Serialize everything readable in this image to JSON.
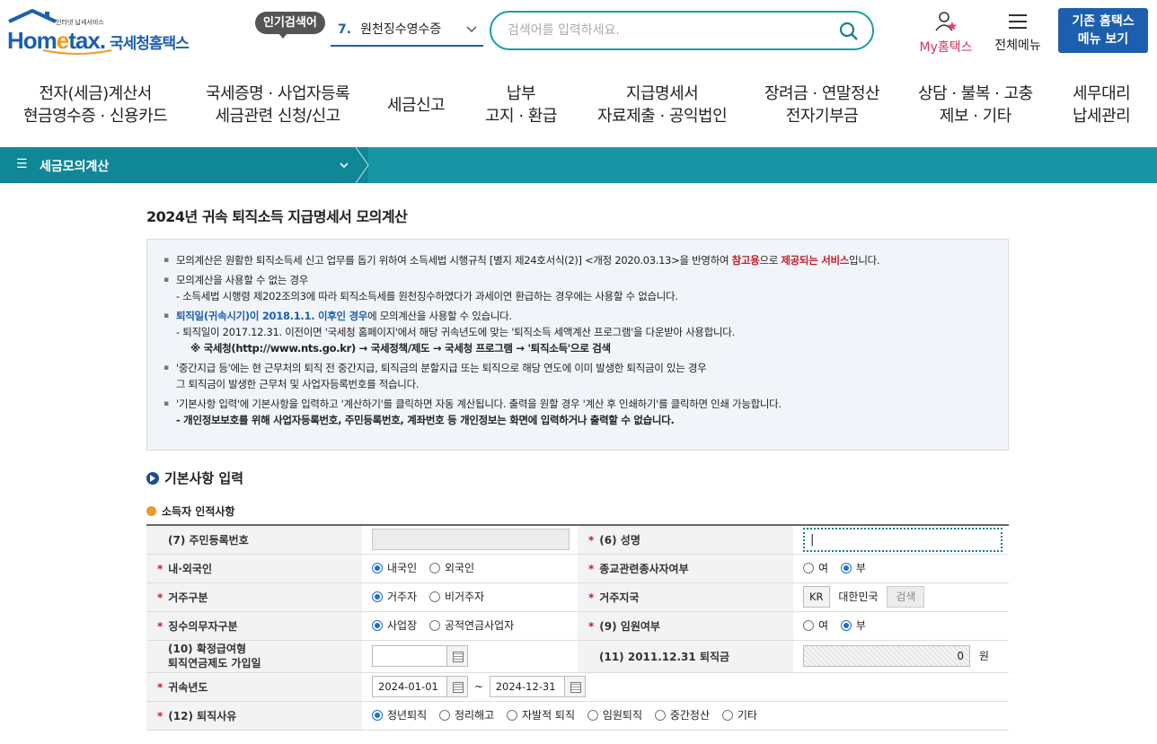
{
  "header": {
    "logo_small": "인터넷 납세서비스",
    "logo_brand_pre": "Hom",
    "logo_brand_e": "e",
    "logo_brand_post": "tax.",
    "logo_kr": "국세청홈택스",
    "popular_badge": "인기검색어",
    "popular_num": "7.",
    "popular_term": "원천징수영수증",
    "search_placeholder": "검색어를 입력하세요.",
    "my_hometax": "My홈택스",
    "all_menu": "전체메뉴",
    "old_hometax_line1": "기존 홈택스",
    "old_hometax_line2": "메뉴 보기"
  },
  "gnb": [
    {
      "l1": "전자(세금)계산서",
      "l2": "현금영수증 · 신용카드"
    },
    {
      "l1": "국세증명 · 사업자등록",
      "l2": "세금관련 신청/신고"
    },
    {
      "l1": "세금신고",
      "l2": ""
    },
    {
      "l1": "납부",
      "l2": "고지 · 환급"
    },
    {
      "l1": "지급명세서",
      "l2": "자료제출 · 공익법인"
    },
    {
      "l1": "장려금 · 연말정산",
      "l2": "전자기부금"
    },
    {
      "l1": "상담 · 불복 · 고충",
      "l2": "제보 · 기타"
    },
    {
      "l1": "세무대리",
      "l2": "납세관리"
    }
  ],
  "subbar": {
    "title": "세금모의계산"
  },
  "page_title": "2024년 귀속 퇴직소득 지급명세서 모의계산",
  "notice": {
    "n1a": "모의계산은 원활한 퇴직소득세 신고 업무를 돕기 위하여 소득세법 시행규칙 [별지 제24호서식(2)] <개정 2020.03.13>을 반영하여 ",
    "n1b": "참고용",
    "n1c": "으로 ",
    "n1d": "제공되는 서비스",
    "n1e": "입니다.",
    "n2": "모의계산을 사용할 수 없는 경우",
    "n2s": "- 소득세법 시행령 제202조의3에 따라 퇴직소득세를 원천징수하였다가 과세이연 환급하는 경우에는 사용할 수 없습니다.",
    "n3a": "퇴직일(귀속시기)이 2018.1.1. 이후인 경우",
    "n3b": "에 모의계산을 사용할 수 있습니다.",
    "n3s": "- 퇴직일이 2017.12.31. 이전이면 '국세청 홈페이지'에서 해당 귀속년도에 맞는 '퇴직소득 세액계산 프로그램'을 다운받아 사용합니다.",
    "n3s2": "※ 국세청(http://www.nts.go.kr) → 국세정책/제도 → 국세청 프로그램 → '퇴직소득'으로 검색",
    "n4": "'중간지급 등'에는 현 근무처의 퇴직 전 중간지급, 퇴직금의 분할지급 또는 퇴직으로 해당 연도에 이미 발생한 퇴직금이 있는 경우",
    "n4s": "그 퇴직금이 발생한 근무처 및 사업자등록번호를 적습니다.",
    "n5": "'기본사항 입력'에 기본사항을 입력하고 '계산하기'를 클릭하면 자동 계산됩니다. 출력을 원할 경우 '계산 후 인쇄하기'를 클릭하면 인쇄 가능합니다.",
    "n5s": "- 개인정보보호를 위해 사업자등록번호, 주민등록번호, 계좌번호 등 개인정보는 화면에 입력하거나 출력할 수 없습니다."
  },
  "section_title": "기본사항 입력",
  "subsection_title": "소득자 인적사항",
  "form": {
    "req_mark": "*",
    "rrn_label": "(7) 주민등록번호",
    "name_label": "(6) 성명",
    "name_value": "|",
    "nat_label": "내·외국인",
    "nat_opt1": "내국인",
    "nat_opt2": "외국인",
    "relig_label": "종교관련종사자여부",
    "yes": "여",
    "no": "부",
    "res_label": "거주구분",
    "res_opt1": "거주자",
    "res_opt2": "비거주자",
    "region_label": "거주지국",
    "region_code": "KR",
    "region_name": "대한민국",
    "search_btn": "검색",
    "duty_label": "징수의무자구분",
    "duty_opt1": "사업장",
    "duty_opt2": "공적연금사업자",
    "exec_label": "(9) 임원여부",
    "dc_label1": "(10) 확정급여형",
    "dc_label2": "퇴직연금제도 가입일",
    "sev2011_label": "(11) 2011.12.31 퇴직금",
    "sev2011_value": "0",
    "won": "원",
    "year_label": "귀속년도",
    "date_from": "2024-01-01",
    "tilde": "~",
    "date_to": "2024-12-31",
    "reason_label": "(12) 퇴직사유",
    "reasons": [
      "정년퇴직",
      "정리해고",
      "자발적 퇴직",
      "임원퇴직",
      "중간정산",
      "기타"
    ]
  }
}
